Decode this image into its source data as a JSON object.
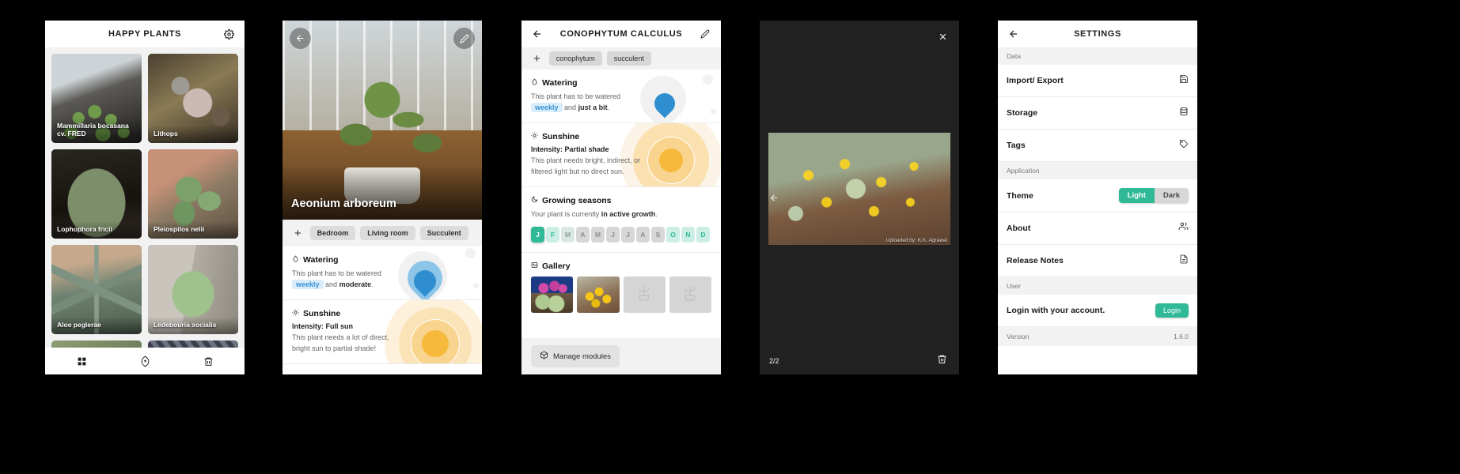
{
  "panel1": {
    "title": "HAPPY PLANTS",
    "gear_icon": "gear-icon",
    "plants": [
      {
        "name": "Mammillaria bocasana cv. FRED"
      },
      {
        "name": "Lithops"
      },
      {
        "name": "Lophophora fricii"
      },
      {
        "name": "Pleiospilos nelii"
      },
      {
        "name": "Aloe peglerae"
      },
      {
        "name": "Ledebouria socialis"
      }
    ],
    "nav": [
      {
        "icon": "grid-icon"
      },
      {
        "icon": "leaf-plus-icon"
      },
      {
        "icon": "trash-icon"
      }
    ]
  },
  "panel2": {
    "back_icon": "back-arrow-icon",
    "edit_icon": "pencil-icon",
    "plant_name": "Aeonium arboreum",
    "tag_add": "+",
    "tags": [
      "Bedroom",
      "Living room",
      "Succulent"
    ],
    "watering": {
      "heading": "Watering",
      "icon": "water-drop-icon",
      "text_before": "This plant has to be watered",
      "frequency": "weekly",
      "conjunction": "and",
      "amount": "moderate",
      "period": "."
    },
    "sunshine": {
      "heading": "Sunshine",
      "icon": "sun-icon",
      "intensity": "Intensity: Full sun",
      "text": "This plant needs a lot of direct, bright sun to partial shade!"
    }
  },
  "panel3": {
    "back_icon": "back-arrow-icon",
    "title": "CONOPHYTUM CALCULUS",
    "edit_icon": "pencil-icon",
    "tag_add": "+",
    "tags": [
      "conophytum",
      "succulent"
    ],
    "watering": {
      "heading": "Watering",
      "icon": "water-drop-icon",
      "text_before": "This plant has to be watered",
      "frequency": "weekly",
      "conjunction": "and",
      "amount": "just a bit",
      "period": "."
    },
    "sunshine": {
      "heading": "Sunshine",
      "icon": "sun-icon",
      "intensity": "Intensity: Partial shade",
      "text": "This plant needs bright, indirect, or filtered light but no direct sun."
    },
    "growing": {
      "heading": "Growing seasons",
      "icon": "moon-icon",
      "text_before": "Your plant is currently",
      "status": "in active growth",
      "period": ".",
      "months": [
        {
          "label": "J",
          "state": "active"
        },
        {
          "label": "F",
          "state": "green"
        },
        {
          "label": "M",
          "state": "green2"
        },
        {
          "label": "A",
          "state": "gray"
        },
        {
          "label": "M",
          "state": "gray"
        },
        {
          "label": "J",
          "state": "gray"
        },
        {
          "label": "J",
          "state": "gray"
        },
        {
          "label": "A",
          "state": "gray"
        },
        {
          "label": "S",
          "state": "gray"
        },
        {
          "label": "O",
          "state": "green"
        },
        {
          "label": "N",
          "state": "green"
        },
        {
          "label": "D",
          "state": "green"
        }
      ]
    },
    "gallery": {
      "heading": "Gallery",
      "icon": "image-icon",
      "slots": [
        "photo-flowering-conophytum",
        "photo-yellow-flowers",
        "empty-cactus-placeholder",
        "empty-cactus-placeholder"
      ]
    },
    "manage_modules": "Manage modules",
    "manage_icon": "cube-icon"
  },
  "panel4": {
    "close_icon": "close-icon",
    "prev_icon": "chevron-left-icon",
    "credit": "Uploaded by: K.K. Agrawal",
    "counter": "2/2",
    "trash_icon": "trash-icon"
  },
  "panel5": {
    "back_icon": "back-arrow-icon",
    "title": "SETTINGS",
    "groups": [
      {
        "label": "Data",
        "rows": [
          {
            "label": "Import/ Export",
            "icon": "save-disk-icon",
            "type": "icon"
          },
          {
            "label": "Storage",
            "icon": "database-icon",
            "type": "icon"
          },
          {
            "label": "Tags",
            "icon": "tag-icon",
            "type": "icon"
          }
        ]
      },
      {
        "label": "Application",
        "rows": [
          {
            "label": "Theme",
            "type": "segmented",
            "options": [
              "Light",
              "Dark"
            ],
            "selected": "Light"
          },
          {
            "label": "About",
            "icon": "people-icon",
            "type": "icon"
          },
          {
            "label": "Release Notes",
            "icon": "document-icon",
            "type": "icon"
          }
        ]
      },
      {
        "label": "User",
        "rows": [
          {
            "label": "Login with your account.",
            "type": "button",
            "button_label": "Login"
          }
        ]
      }
    ],
    "version_label": "Version",
    "version_value": "1.6.0"
  },
  "colors": {
    "accent_green": "#2fb997",
    "accent_blue": "#2e8ed0",
    "accent_yellow": "#f6b93b",
    "panel_bg": "#ffffff",
    "page_bg": "#000000"
  }
}
